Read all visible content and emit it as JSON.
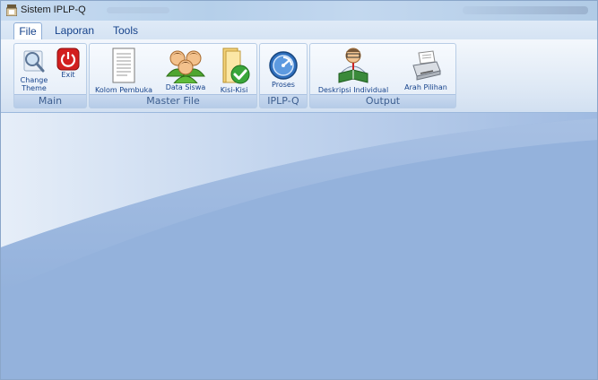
{
  "window": {
    "title": "Sistem IPLP-Q"
  },
  "menu": {
    "tabs": [
      "File",
      "Laporan",
      "Tools"
    ],
    "active": "File"
  },
  "ribbon": {
    "groups": [
      {
        "label": "Main",
        "buttons": [
          {
            "label": "Change Theme",
            "line1": "Change",
            "line2": "Theme",
            "icon": "magnifier-icon"
          },
          {
            "label": "Exit",
            "icon": "power-icon"
          }
        ]
      },
      {
        "label": "Master File",
        "buttons": [
          {
            "label": "Kolom Pembuka",
            "icon": "document-icon"
          },
          {
            "label": "Data Siswa",
            "icon": "users-icon"
          },
          {
            "label": "Kisi-Kisi",
            "icon": "folder-check-icon"
          }
        ]
      },
      {
        "label": "IPLP-Q",
        "buttons": [
          {
            "label": "Proses",
            "icon": "process-icon"
          }
        ]
      },
      {
        "label": "Output",
        "buttons": [
          {
            "label": "Deskripsi Individual",
            "icon": "person-book-icon"
          },
          {
            "label": "Arah Pilihan",
            "icon": "printer-icon"
          }
        ]
      }
    ]
  },
  "colors": {
    "accent": "#15428b",
    "workspace": "#94b2dc",
    "ribbon": "#dde8f5"
  }
}
